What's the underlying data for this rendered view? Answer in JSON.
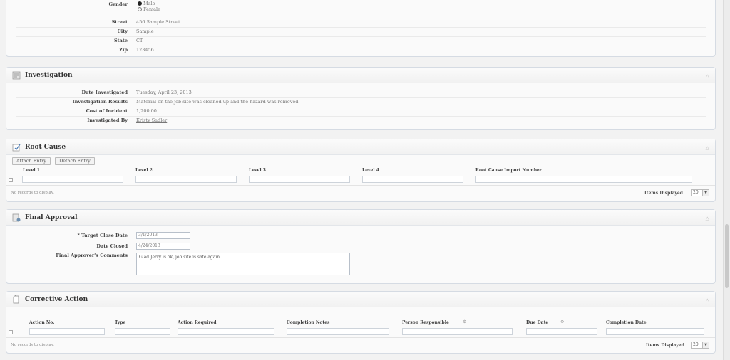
{
  "personal": {
    "gender_label": "Gender",
    "gender_options": [
      "Male",
      "Female"
    ],
    "fields": [
      {
        "label": "Street",
        "value": "456 Sample Street"
      },
      {
        "label": "City",
        "value": "Sample"
      },
      {
        "label": "State",
        "value": "CT"
      },
      {
        "label": "Zip",
        "value": "123456"
      }
    ]
  },
  "investigation": {
    "title": "Investigation",
    "fields": [
      {
        "label": "Date Investigated",
        "value": "Tuesday, April 23, 2013"
      },
      {
        "label": "Investigation Results",
        "value": "Material on the job site was cleaned up and the hazard was removed"
      },
      {
        "label": "Cost of Incident",
        "value": "1,200.00"
      },
      {
        "label": "Investigated By",
        "value": "Kristy Sadler"
      }
    ]
  },
  "root_cause": {
    "title": "Root Cause",
    "attach_label": "Attach Entry",
    "detach_label": "Detach Entry",
    "columns": [
      "Level 1",
      "Level 2",
      "Level 3",
      "Level 4",
      "Root Cause Import Number"
    ],
    "empty_text": "No records to display.",
    "items_label": "Items Displayed",
    "items_value": "20"
  },
  "final_approval": {
    "title": "Final Approval",
    "target_label": "* Target Close Date",
    "target_value": "3/1/2013",
    "closed_label": "Date Closed",
    "closed_value": "4/24/2013",
    "comments_label": "Final Approver's Comments",
    "comments_value": "Glad Jerry is ok, job site is safe again."
  },
  "corrective_action": {
    "title": "Corrective Action",
    "columns": [
      "Action No.",
      "Type",
      "Action Required",
      "Completion Notes",
      "Person Responsible",
      "Due Date",
      "Completion Date"
    ],
    "empty_text": "No records to display.",
    "items_label": "Items Displayed",
    "items_value": "20"
  }
}
